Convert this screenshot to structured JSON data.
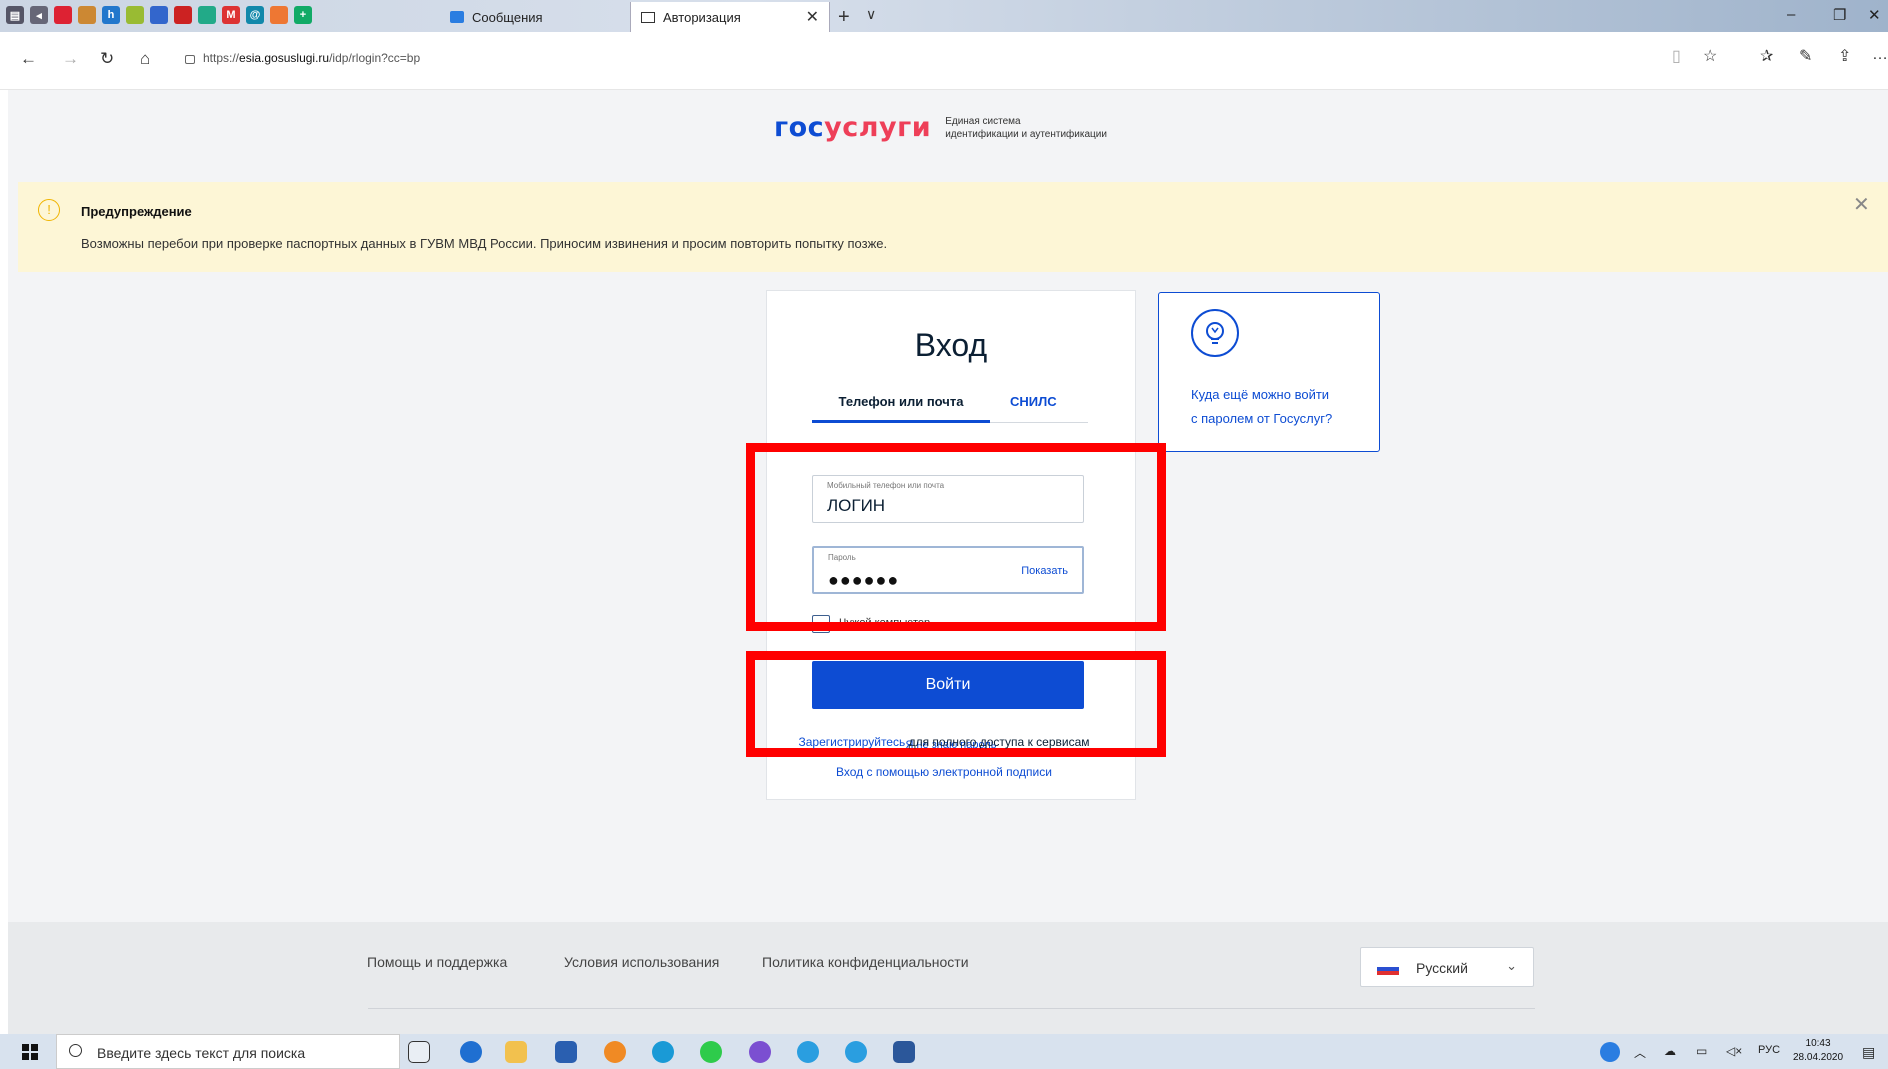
{
  "browser": {
    "tabs": [
      {
        "title": "Сообщения"
      },
      {
        "title": "Авторизация"
      }
    ],
    "url": {
      "scheme": "https://",
      "domain": "esia.gosuslugi.ru",
      "path": "/idp/rlogin?cc=bp"
    }
  },
  "header": {
    "logo_part1": "гос",
    "logo_part2": "услуги",
    "logo_sub_line1": "Единая система",
    "logo_sub_line2": "идентификации и аутентификации"
  },
  "alert": {
    "title": "Предупреждение",
    "text": "Возможны перебои при проверке паспортных данных в ГУВМ МВД России. Приносим извинения и просим повторить попытку позже."
  },
  "login": {
    "title": "Вход",
    "tab_phone": "Телефон или почта",
    "tab_snils": "СНИЛС",
    "login_label": "Мобильный телефон или почта",
    "login_value": "ЛОГИН",
    "password_label": "Пароль",
    "password_value": "●●●●●●",
    "show_password": "Показать",
    "remember": "Чужой компьютер",
    "submit": "Войти",
    "forgot": "Я не знаю пароль"
  },
  "side": {
    "line1": "Куда ещё можно войти",
    "line2": "с паролем от Госуслуг?"
  },
  "links": {
    "register": "Зарегистрируйтесь",
    "register_rest": " для полного доступа к сервисам",
    "esign": "Вход с помощью электронной подписи"
  },
  "footer": {
    "help": "Помощь и поддержка",
    "terms": "Условия использования",
    "privacy": "Политика конфиденциальности",
    "language": "Русский"
  },
  "taskbar": {
    "search_placeholder": "Введите здесь текст для поиска",
    "lang": "РУС",
    "time": "10:43",
    "date": "28.04.2020"
  },
  "colors": {
    "brand_blue": "#0d4cd3",
    "brand_red": "#ee3f58",
    "annotation_red": "#ff0000",
    "alert_bg": "#fdf6d6"
  }
}
